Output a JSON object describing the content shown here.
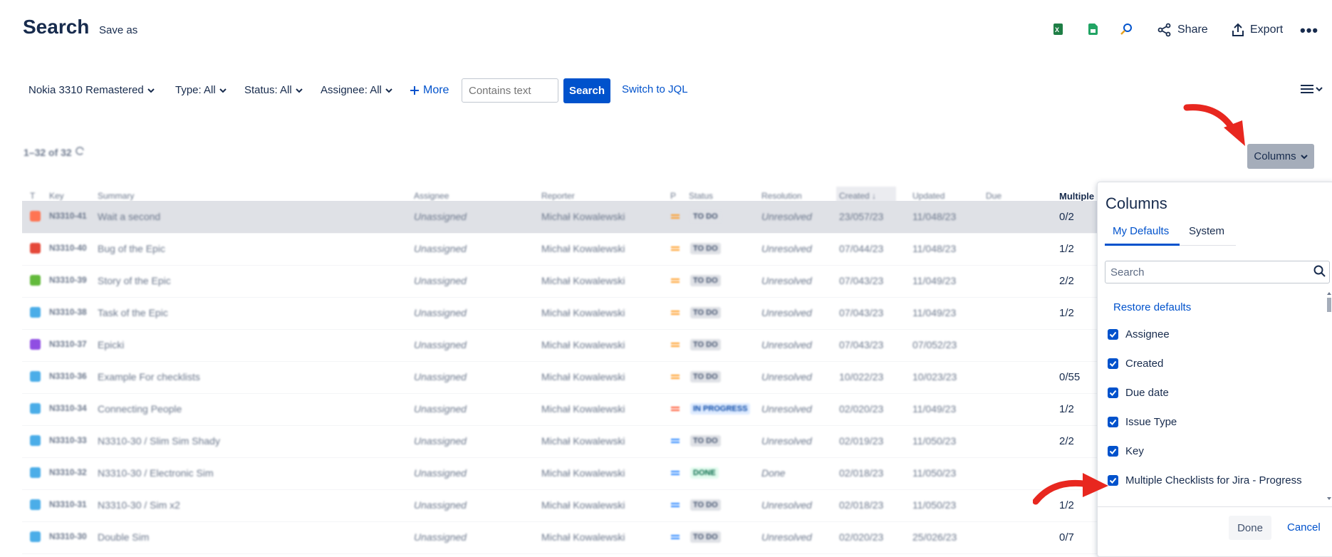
{
  "header": {
    "title": "Search",
    "save_as": "Save as",
    "share": "Share",
    "export": "Export",
    "more": "•••"
  },
  "filters": {
    "project": "Nokia 3310 Remastered",
    "type": "Type: All",
    "status": "Status: All",
    "assignee": "Assignee: All",
    "more": "More",
    "text_placeholder": "Contains text",
    "search_button": "Search",
    "switch_jql": "Switch to JQL"
  },
  "results": {
    "count": "1–32 of 32",
    "columns_button": "Columns"
  },
  "table": {
    "headers": {
      "t": "T",
      "key": "Key",
      "summary": "Summary",
      "assignee": "Assignee",
      "reporter": "Reporter",
      "p": "P",
      "status": "Status",
      "resolution": "Resolution",
      "created": "Created",
      "updated": "Updated",
      "due": "Due",
      "multiple": "Multiple"
    },
    "rows": [
      {
        "type": "bug-orange",
        "key": "N3310-41",
        "summary": "Wait a second",
        "assignee": "Unassigned",
        "reporter": "Michał Kowalewski",
        "priority": "medium",
        "status": "TO DO",
        "resolution": "Unresolved",
        "created": "23/057/23",
        "updated": "11/048/23",
        "progress": "0/2"
      },
      {
        "type": "bug",
        "key": "N3310-40",
        "summary": "Bug of the Epic",
        "assignee": "Unassigned",
        "reporter": "Michał Kowalewski",
        "priority": "medium",
        "status": "TO DO",
        "resolution": "Unresolved",
        "created": "07/044/23",
        "updated": "11/048/23",
        "progress": "1/2"
      },
      {
        "type": "story",
        "key": "N3310-39",
        "summary": "Story of the Epic",
        "assignee": "Unassigned",
        "reporter": "Michał Kowalewski",
        "priority": "medium",
        "status": "TO DO",
        "resolution": "Unresolved",
        "created": "07/043/23",
        "updated": "11/049/23",
        "progress": "2/2"
      },
      {
        "type": "task",
        "key": "N3310-38",
        "summary": "Task of the Epic",
        "assignee": "Unassigned",
        "reporter": "Michał Kowalewski",
        "priority": "medium",
        "status": "TO DO",
        "resolution": "Unresolved",
        "created": "07/043/23",
        "updated": "11/049/23",
        "progress": "1/2"
      },
      {
        "type": "epic",
        "key": "N3310-37",
        "summary": "Epicki",
        "assignee": "Unassigned",
        "reporter": "Michał Kowalewski",
        "priority": "medium",
        "status": "TO DO",
        "resolution": "Unresolved",
        "created": "07/043/23",
        "updated": "07/052/23",
        "progress": ""
      },
      {
        "type": "task",
        "key": "N3310-36",
        "summary": "Example For checklists",
        "assignee": "Unassigned",
        "reporter": "Michał Kowalewski",
        "priority": "medium",
        "status": "TO DO",
        "resolution": "Unresolved",
        "created": "10/022/23",
        "updated": "10/023/23",
        "progress": "0/55"
      },
      {
        "type": "task",
        "key": "N3310-34",
        "summary": "Connecting People",
        "assignee": "Unassigned",
        "reporter": "Michał Kowalewski",
        "priority": "high",
        "status": "IN PROGRESS",
        "resolution": "Unresolved",
        "created": "02/020/23",
        "updated": "11/049/23",
        "progress": "1/2"
      },
      {
        "type": "subtask",
        "key": "N3310-33",
        "summary": "N3310-30 / Slim Sim Shady",
        "assignee": "Unassigned",
        "reporter": "Michał Kowalewski",
        "priority": "low",
        "status": "TO DO",
        "resolution": "Unresolved",
        "created": "02/019/23",
        "updated": "11/050/23",
        "progress": "2/2"
      },
      {
        "type": "subtask",
        "key": "N3310-32",
        "summary": "N3310-30 / Electronic Sim",
        "assignee": "Unassigned",
        "reporter": "Michał Kowalewski",
        "priority": "low",
        "status": "DONE",
        "resolution": "Done",
        "created": "02/018/23",
        "updated": "11/050/23",
        "progress": ""
      },
      {
        "type": "subtask",
        "key": "N3310-31",
        "summary": "N3310-30 / Sim x2",
        "assignee": "Unassigned",
        "reporter": "Michał Kowalewski",
        "priority": "low",
        "status": "TO DO",
        "resolution": "Unresolved",
        "created": "02/018/23",
        "updated": "11/050/23",
        "progress": "1/2"
      },
      {
        "type": "task",
        "key": "N3310-30",
        "summary": "Double Sim",
        "assignee": "Unassigned",
        "reporter": "Michał Kowalewski",
        "priority": "lowest",
        "status": "TO DO",
        "resolution": "Unresolved",
        "created": "02/020/23",
        "updated": "25/026/23",
        "progress": "0/7"
      }
    ]
  },
  "columns_panel": {
    "title": "Columns",
    "tabs": [
      "My Defaults",
      "System"
    ],
    "search_placeholder": "Search",
    "restore": "Restore defaults",
    "options": [
      {
        "label": "Assignee",
        "checked": true
      },
      {
        "label": "Created",
        "checked": true
      },
      {
        "label": "Due date",
        "checked": true
      },
      {
        "label": "Issue Type",
        "checked": true
      },
      {
        "label": "Key",
        "checked": true
      },
      {
        "label": "Multiple Checklists for Jira - Progress",
        "checked": true
      }
    ],
    "done": "Done",
    "cancel": "Cancel"
  },
  "colors": {
    "accent": "#0052cc",
    "annotation_arrow": "#e8271f",
    "selected_row": "#dfe1e6"
  }
}
